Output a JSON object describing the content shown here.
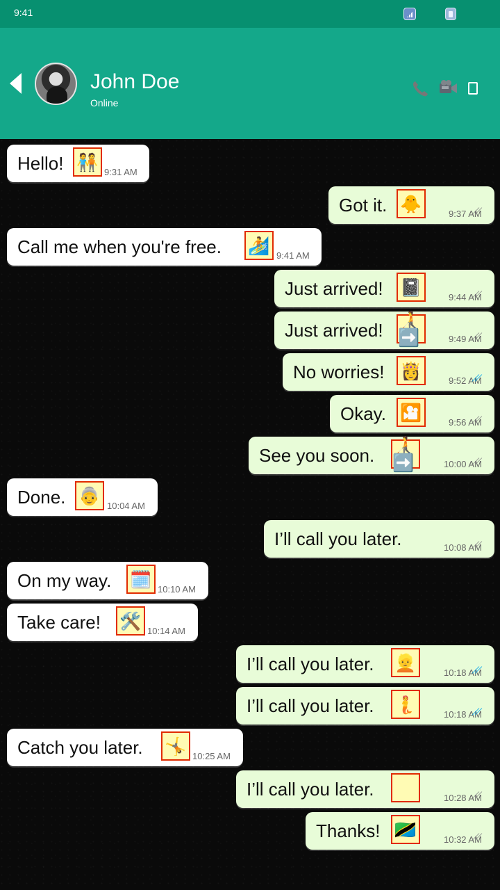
{
  "status_bar": {
    "time": "9:41",
    "icons": [
      "signal-icon",
      "battery-icon"
    ]
  },
  "header": {
    "contact_name": "John Doe",
    "contact_status": "Online",
    "icons": [
      "back-icon",
      "avatar",
      "call-icon",
      "video-call-icon",
      "menu-icon"
    ],
    "colors": {
      "status_bar": "#079070",
      "header": "#14a88a",
      "outgoing_bubble": "#e8fcd8",
      "incoming_bubble": "#ffffff",
      "read_check": "#00a6ee"
    }
  },
  "messages": [
    {
      "direction": "incoming",
      "text": "Hello!",
      "emoji": "🧑‍🤝‍🧑",
      "time": "9:31 AM",
      "status": ""
    },
    {
      "direction": "outgoing",
      "text": "Got it.",
      "emoji": "🐥",
      "time": "9:37 AM",
      "status": "sent"
    },
    {
      "direction": "incoming",
      "text": "Call me when you're free.",
      "emoji": "🏄",
      "time": "9:41 AM",
      "status": ""
    },
    {
      "direction": "outgoing",
      "text": "Just arrived!",
      "emoji": "📓",
      "time": "9:44 AM",
      "status": "sent"
    },
    {
      "direction": "outgoing",
      "text": "Just arrived!",
      "emoji": "🧑‍🦯➡️",
      "time": "9:49 AM",
      "status": "delivered"
    },
    {
      "direction": "outgoing",
      "text": "No worries!",
      "emoji": "👸",
      "time": "9:52 AM",
      "status": "read"
    },
    {
      "direction": "outgoing",
      "text": "Okay.",
      "emoji": "🎦",
      "time": "9:56 AM",
      "status": "delivered"
    },
    {
      "direction": "outgoing",
      "text": "See you soon.",
      "emoji": "🧑‍🦯➡️",
      "time": "10:00 AM",
      "status": "sent"
    },
    {
      "direction": "incoming",
      "text": "Done.",
      "emoji": "👵",
      "time": "10:04 AM",
      "status": ""
    },
    {
      "direction": "outgoing",
      "text": "I’ll call you later.",
      "emoji": "",
      "time": "10:08 AM",
      "status": "sent"
    },
    {
      "direction": "incoming",
      "text": "On my way.",
      "emoji": "🗓️",
      "time": "10:10 AM",
      "status": ""
    },
    {
      "direction": "incoming",
      "text": "Take care!",
      "emoji": "🛠️",
      "time": "10:14 AM",
      "status": ""
    },
    {
      "direction": "outgoing",
      "text": "I’ll call you later.",
      "emoji": "👱",
      "time": "10:18 AM",
      "status": "read"
    },
    {
      "direction": "outgoing",
      "text": "I’ll call you later.",
      "emoji": "🧜",
      "time": "10:18 AM",
      "status": "read"
    },
    {
      "direction": "incoming",
      "text": "Catch you later.",
      "emoji": "🤸",
      "time": "10:25 AM",
      "status": ""
    },
    {
      "direction": "outgoing",
      "text": "I’ll call you later.",
      "emoji": "",
      "time": "10:28 AM",
      "status": "delivered"
    },
    {
      "direction": "outgoing",
      "text": "Thanks!",
      "emoji": "🇹🇿",
      "time": "10:32 AM",
      "status": "sent"
    }
  ]
}
